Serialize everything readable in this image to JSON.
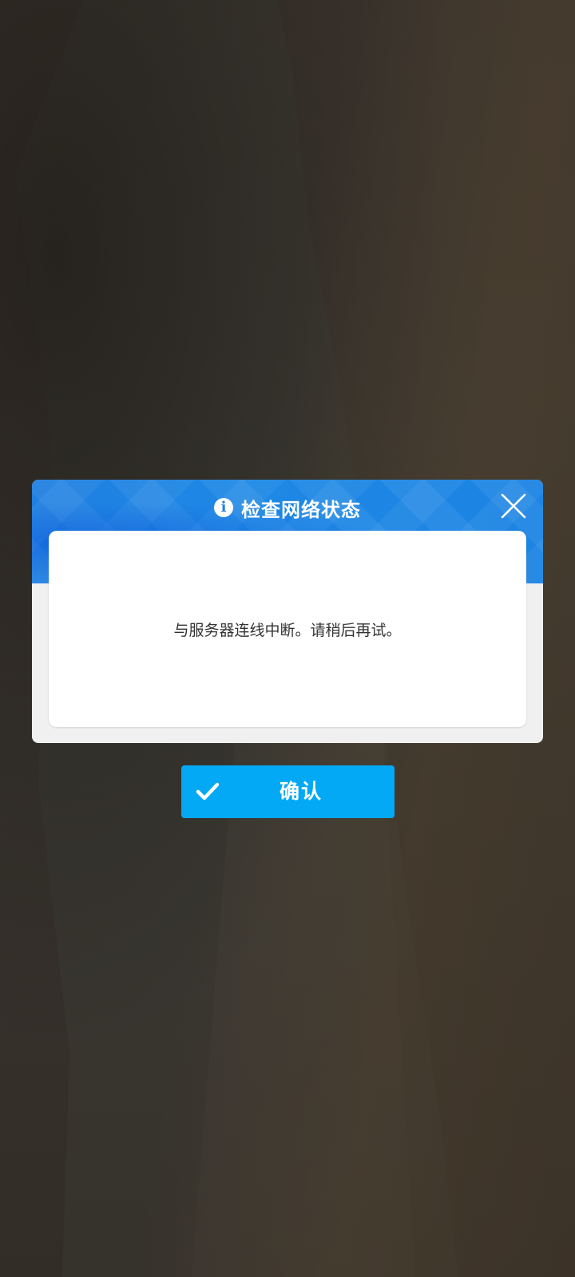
{
  "dialog": {
    "title": "检查网络状态",
    "title_icon": "info-icon",
    "info_glyph": "i",
    "close_icon": "close-icon",
    "message": "与服务器连线中断。请稍后再试。"
  },
  "confirm_button": {
    "label": "确认",
    "icon": "check-icon"
  },
  "colors": {
    "header_blue": "#1e88e5",
    "confirm_blue": "#03a9f4",
    "panel_gray": "#f0f0f0",
    "text_dark": "#333333"
  }
}
